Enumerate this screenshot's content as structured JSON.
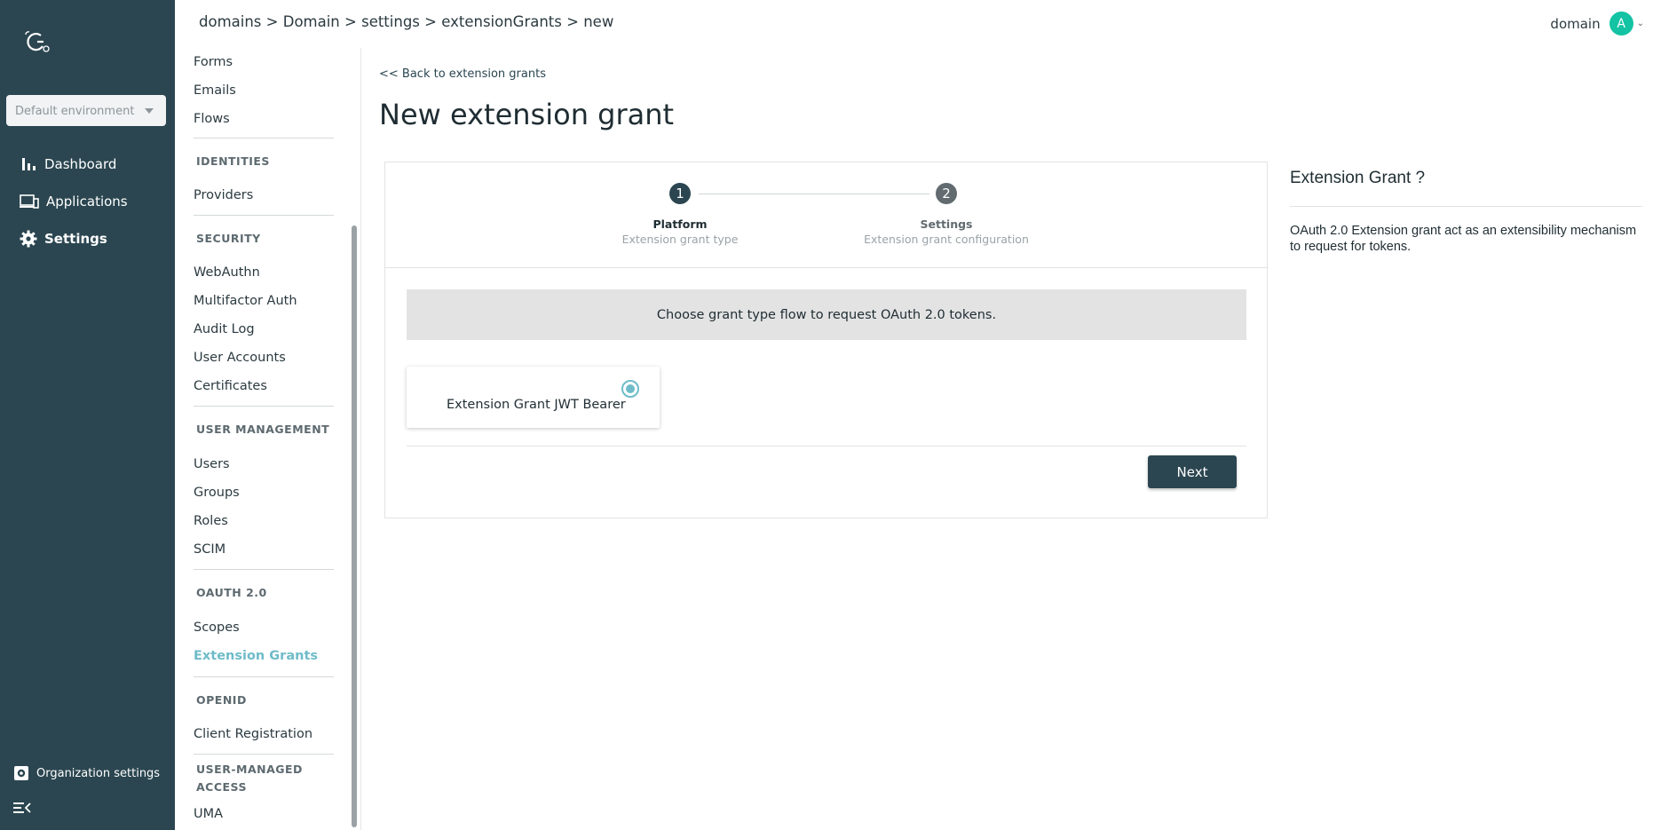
{
  "env": {
    "selected": "Default environment"
  },
  "rail": {
    "items": [
      {
        "label": "Dashboard",
        "icon": "bar-chart-icon"
      },
      {
        "label": "Applications",
        "icon": "devices-icon"
      },
      {
        "label": "Settings",
        "icon": "gear-icon",
        "active": true
      }
    ],
    "org_settings": "Organization settings"
  },
  "breadcrumb": {
    "parts": [
      "domains",
      "Domain",
      "settings",
      "extensionGrants",
      "new"
    ],
    "separator": ">"
  },
  "user": {
    "name": "domain",
    "avatar_initial": "A",
    "avatar_color": "#13c3a3"
  },
  "subnav": {
    "forms": "Forms",
    "emails": "Emails",
    "flows": "Flows",
    "identities": "IDENTITIES",
    "providers": "Providers",
    "security": "SECURITY",
    "webauthn": "WebAuthn",
    "mfa": "Multifactor Auth",
    "audit": "Audit Log",
    "accounts": "User Accounts",
    "certificates": "Certificates",
    "user_mgmt": "USER MANAGEMENT",
    "users": "Users",
    "groups": "Groups",
    "roles": "Roles",
    "scim": "SCIM",
    "oauth": "OAUTH 2.0",
    "scopes": "Scopes",
    "ext_grants": "Extension Grants",
    "openid": "OPENID",
    "client_reg": "Client Registration",
    "uma_section_1": "USER-MANAGED",
    "uma_section_2": "ACCESS",
    "uma": "UMA"
  },
  "main": {
    "back_link": "<< Back to extension grants",
    "title": "New extension grant",
    "steps": [
      {
        "number": "1",
        "title": "Platform",
        "subtitle": "Extension grant type",
        "active": true
      },
      {
        "number": "2",
        "title": "Settings",
        "subtitle": "Extension grant configuration",
        "active": false
      }
    ],
    "banner": "Choose grant type flow to request OAuth 2.0 tokens.",
    "option": {
      "label": "Extension Grant JWT Bearer",
      "selected": true
    },
    "next_label": "Next"
  },
  "help": {
    "title": "Extension Grant ?",
    "text": "OAuth 2.0 Extension grant act as an extensibility mechanism to request for tokens."
  },
  "colors": {
    "rail": "#2b4650",
    "accent": "#6fbcc9",
    "step_active": "#2b4650",
    "step_inactive": "#616b70"
  }
}
